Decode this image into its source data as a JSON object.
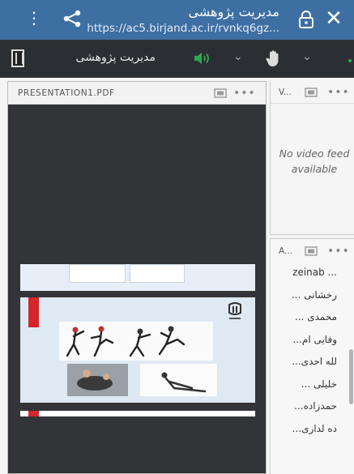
{
  "window": {
    "title": "مدیریت پژوهشی",
    "url": "https://ac5.birjand.ac.ir/rvnkq6gz...",
    "menu_icon": "more-vert-icon",
    "share_icon": "share-icon",
    "lock_icon": "lock-icon",
    "close_icon": "close-icon",
    "close_glyph": "✕",
    "menu_glyph": "⋮",
    "bar_color": "#3e6fa3"
  },
  "toolbar": {
    "meeting_title": "مدیریت پژوهشی",
    "speaker_icon": "speaker-on-icon",
    "hand_icon": "raise-hand-icon",
    "chevron_glyph": "⌄",
    "speaker_color": "#2ea84f"
  },
  "share_pod": {
    "title": "PRESENTATION1.PDF",
    "more_glyph": "•••"
  },
  "video_pod": {
    "title": "V...",
    "more_glyph": "•••",
    "message": "No video feed available"
  },
  "attendees_pod": {
    "title": "A...",
    "more_glyph": "•••",
    "attendees": [
      "zeinab ...",
      "... رخشانی",
      "... محمدی",
      "...وفایی ام",
      "...لله احدی",
      "... خلیلی",
      "...حمدزاده",
      "...ده لداری"
    ]
  }
}
